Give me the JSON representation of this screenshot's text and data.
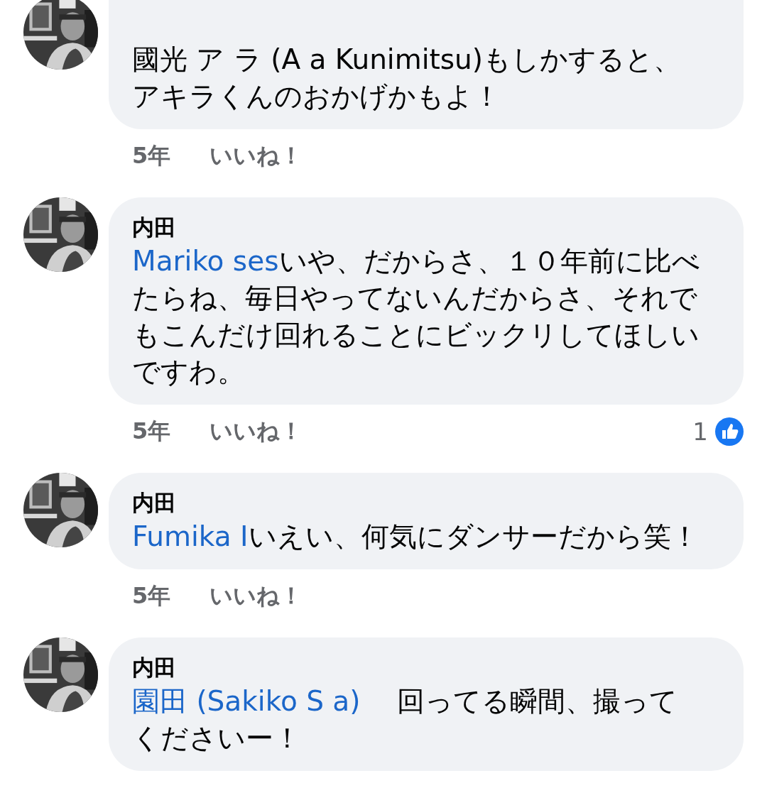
{
  "comments": [
    {
      "text": "國光 ア ラ (A a Kunimitsu)もしかすると、アキラくんのおかげかもよ！",
      "time": "5年",
      "like_label": "いいね！"
    },
    {
      "name": "内田",
      "mention": "Mariko ses",
      "text": "いや、だからさ、１０年前に比べたらね、毎日やってないんだからさ、それでもこんだけ回れることにビックリしてほしいですわ。",
      "time": "5年",
      "like_label": "いいね！",
      "reaction_count": "1"
    },
    {
      "name": "内田",
      "mention": "Fumika I",
      "text": "いえい、何気にダンサーだから笑！",
      "time": "5年",
      "like_label": "いいね！"
    },
    {
      "name": "内田",
      "mention": "園田 (Sakiko S a)",
      "text": "　 回ってる瞬間、撮ってくださいー！"
    }
  ]
}
